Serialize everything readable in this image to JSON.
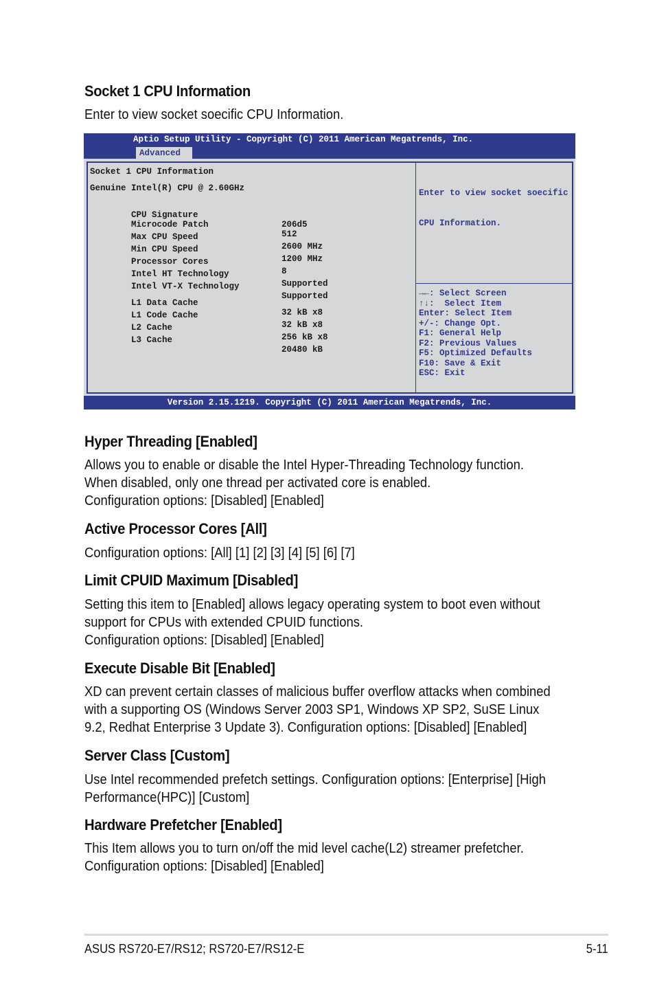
{
  "intro": {
    "heading": "Socket 1 CPU Information",
    "description": "Enter to view socket soecific CPU Information."
  },
  "bios": {
    "title": "Aptio Setup Utility - Copyright (C) 2011 American Megatrends, Inc.",
    "active_tab": "Advanced",
    "section_title": "Socket 1 CPU Information",
    "cpu_name": "Genuine Intel(R) CPU @ 2.60GHz",
    "info_rows": [
      {
        "label": "CPU Signature",
        "value": "206d5"
      },
      {
        "label": "Microcode Patch",
        "value": "512"
      },
      {
        "label": "Max CPU Speed",
        "value": "2600 MHz"
      },
      {
        "label": "Min CPU Speed",
        "value": "1200 MHz"
      },
      {
        "label": "Processor Cores",
        "value": "8"
      },
      {
        "label": "Intel HT Technology",
        "value": "Supported"
      },
      {
        "label": "Intel VT-X Technology",
        "value": "Supported"
      }
    ],
    "cache_rows": [
      {
        "label": "L1 Data Cache",
        "value": "32 kB x8"
      },
      {
        "label": "L1 Code Cache",
        "value": "32 kB x8"
      },
      {
        "label": "L2 Cache",
        "value": "256 kB x8"
      },
      {
        "label": "L3 Cache",
        "value": "20480 kB"
      }
    ],
    "help_text": [
      "Enter to view socket soecific",
      "CPU Information."
    ],
    "keys": [
      "→←: Select Screen",
      "↑↓:  Select Item",
      "Enter: Select Item",
      "+/-: Change Opt.",
      "F1: General Help",
      "F2: Previous Values",
      "F5: Optimized Defaults",
      "F10: Save & Exit",
      "ESC: Exit"
    ],
    "footer": "Version 2.15.1219. Copyright (C) 2011 American Megatrends, Inc.",
    "colors": {
      "frame": "#303a8c",
      "background": "#d6d7d9"
    }
  },
  "sections": [
    {
      "heading": "Hyper Threading [Enabled]",
      "lines": [
        "Allows you to enable or disable the Intel Hyper-Threading Technology function.",
        "When disabled, only one thread per activated core is enabled.",
        "Configuration options: [Disabled] [Enabled]"
      ]
    },
    {
      "heading": "Active Processor Cores [All]",
      "lines": [
        "Configuration options: [All] [1] [2] [3] [4] [5] [6] [7]"
      ]
    },
    {
      "heading": "Limit CPUID Maximum [Disabled]",
      "lines": [
        "Setting this item to [Enabled] allows legacy operating system to boot even without",
        "support for CPUs with extended CPUID functions.",
        "Configuration options: [Disabled] [Enabled]"
      ]
    },
    {
      "heading": "Execute Disable Bit [Enabled]",
      "lines": [
        "XD can prevent certain classes of malicious buffer overflow attacks when combined",
        "with a supporting OS (Windows Server 2003 SP1, Windows XP SP2, SuSE Linux",
        "9.2, Redhat Enterprise 3 Update 3). Configuration options: [Disabled] [Enabled]"
      ]
    },
    {
      "heading": "Server Class [Custom]",
      "lines": [
        "Use Intel recommended prefetch settings. Configuration options: [Enterprise] [High",
        "Performance(HPC)] [Custom]"
      ]
    },
    {
      "heading": "Hardware Prefetcher [Enabled]",
      "lines": [
        "This Item allows you to turn on/off the mid level cache(L2) streamer prefetcher.",
        "Configuration options: [Disabled] [Enabled]"
      ]
    }
  ],
  "footer": {
    "product": "ASUS RS720-E7/RS12; RS720-E7/RS12-E",
    "page_number": "5-11"
  }
}
